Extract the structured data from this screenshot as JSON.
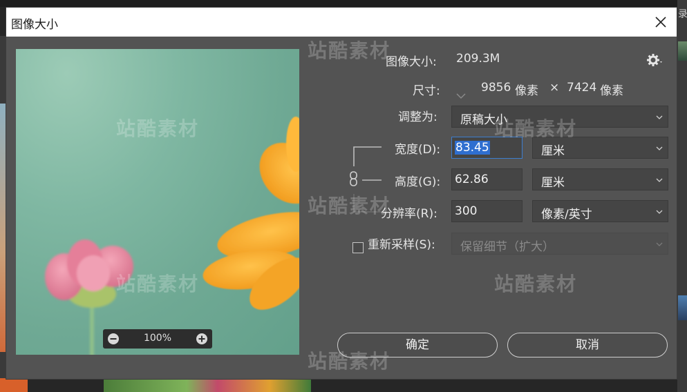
{
  "background": {
    "right_label": "录"
  },
  "dialog": {
    "title": "图像大小",
    "close_label": "✕"
  },
  "preview": {
    "zoom_level": "100%"
  },
  "info": {
    "image_size_label": "图像大小:",
    "image_size_value": "209.3M",
    "dimensions_label": "尺寸:",
    "dimensions_width": "9856",
    "dimensions_width_unit": "像素",
    "dimensions_times": "×",
    "dimensions_height": "7424",
    "dimensions_height_unit": "像素",
    "fit_to_label": "调整为:",
    "fit_to_value": "原稿大小"
  },
  "fields": {
    "width_label": "宽度(D):",
    "width_value": "83.45",
    "width_unit": "厘米",
    "height_label": "高度(G):",
    "height_value": "62.86",
    "height_unit": "厘米",
    "resolution_label": "分辨率(R):",
    "resolution_value": "300",
    "resolution_unit": "像素/英寸",
    "resample_label": "重新采样(S):",
    "resample_checked": false,
    "resample_method": "保留细节（扩大）"
  },
  "buttons": {
    "ok_label": "确定",
    "cancel_label": "取消"
  },
  "watermark": {
    "text": "站酷素材"
  },
  "colors": {
    "dialog_bg": "#535353",
    "field_bg": "#454545",
    "selection": "#2f6fd0",
    "preview_green": "#6fa994",
    "flower_orange": "#f2a020",
    "flower_pink": "#e8889e"
  }
}
